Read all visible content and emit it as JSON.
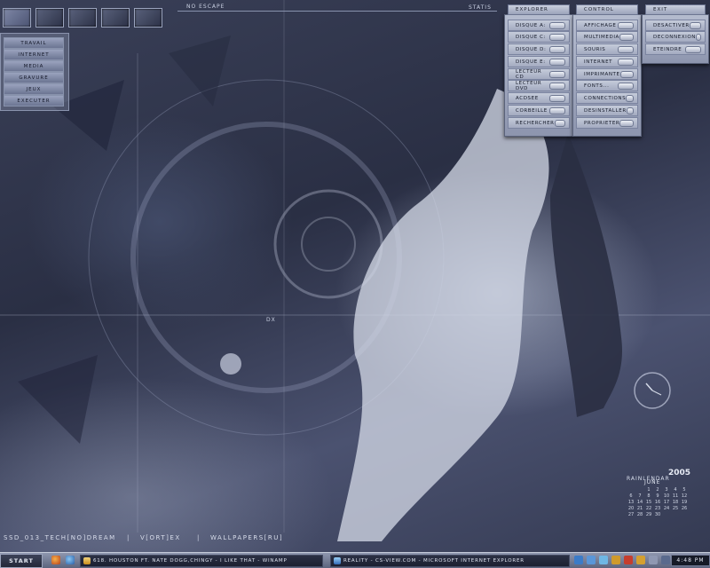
{
  "top": {
    "title": "NO ESCAPE",
    "right_tag": "STATIS"
  },
  "left_menu": {
    "items": [
      {
        "label": "TRAVAIL"
      },
      {
        "label": "INTERNET"
      },
      {
        "label": "MEDIA"
      },
      {
        "label": "GRAVURE"
      },
      {
        "label": "JEUX"
      },
      {
        "label": "EXECUTER"
      }
    ]
  },
  "explorer": {
    "title": "EXPLORER",
    "items": [
      "Disque A:",
      "Disque C:",
      "Disque D:",
      "Disque E:",
      "Lecteur CD",
      "Lecteur DVD",
      "ACDSee",
      "Corbeille",
      "Rechercher"
    ]
  },
  "control": {
    "title": "CONTROL",
    "items": [
      "Affichage",
      "Multimedia",
      "Souris",
      "Internet",
      "Imprimante",
      "Fonts...",
      "Connections",
      "Desinstaller",
      "Proprieter"
    ]
  },
  "exit": {
    "title": "EXIT",
    "items": [
      "Desactiver",
      "Deconnexion",
      "Eteindre"
    ]
  },
  "wallpaper_labels": {
    "dx": "DX",
    "caption_left": "SSD_013_TECH[NO]DREAM",
    "caption_mid": "V[ORT]EX",
    "caption_right": "WALLPAPERS[RU]"
  },
  "calendar": {
    "brand": "RAINLENDAR",
    "year": "2005",
    "month": "JUNE",
    "days": [
      "1",
      "2",
      "3",
      "4",
      "5",
      "6",
      "7",
      "8",
      "9",
      "10",
      "11",
      "12",
      "13",
      "14",
      "15",
      "16",
      "17",
      "18",
      "19",
      "20",
      "21",
      "22",
      "23",
      "24",
      "25",
      "26",
      "27",
      "28",
      "29",
      "30"
    ]
  },
  "taskbar": {
    "start_label": "START",
    "task1": "618. HOUSTON FT. NATE DOGG,CHINGY - I LIKE THAT - WINAMP",
    "task2": "REALITY - CS-VIEW.COM - MICROSOFT INTERNET EXPLORER",
    "clock": "4:48 PM"
  }
}
